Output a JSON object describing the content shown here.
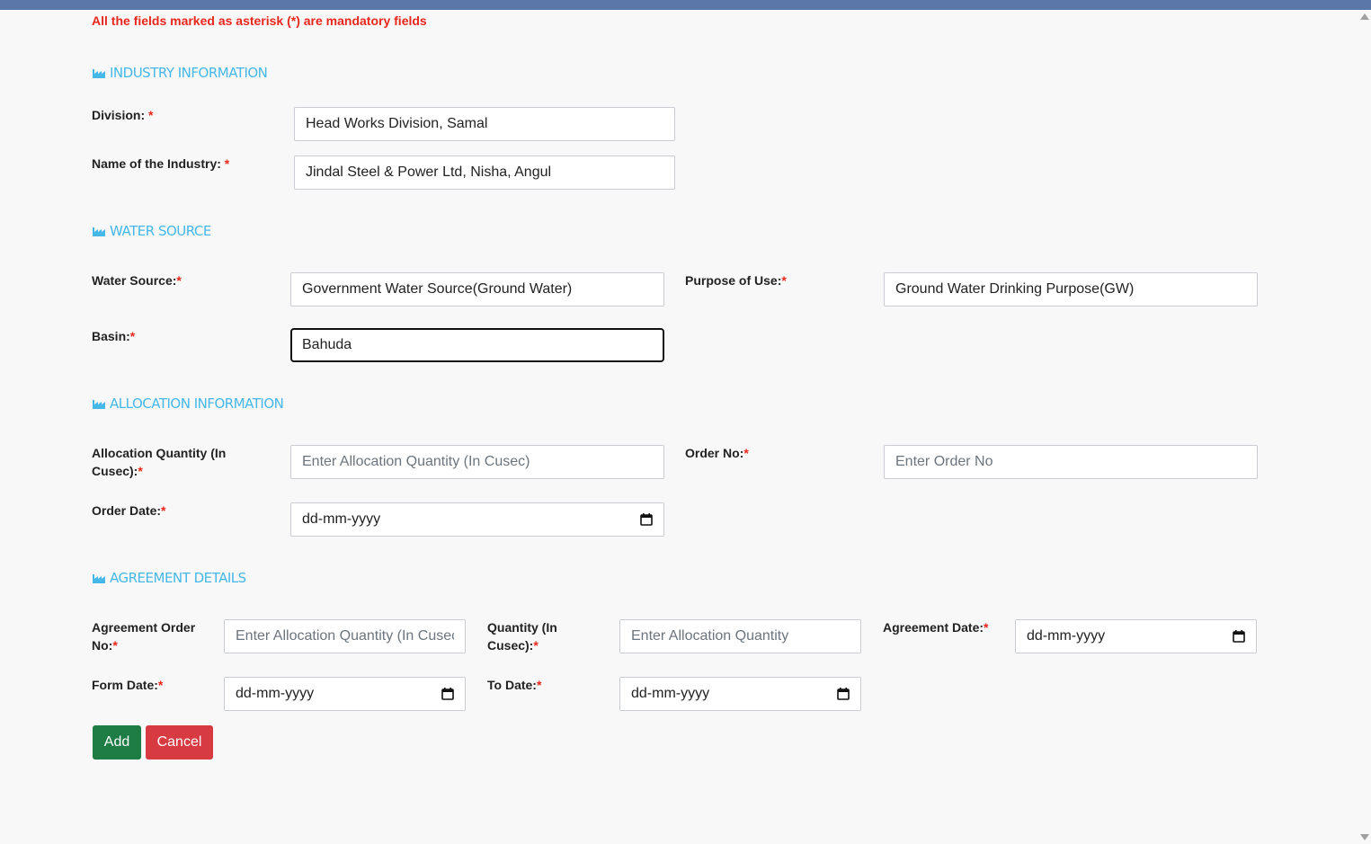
{
  "notice": "All the fields marked as asterisk (*) are mandatory fields",
  "colors": {
    "accent": "#45b8e8",
    "required": "#e8261c",
    "add": "#1e7c45",
    "cancel": "#d83a42",
    "topbar": "#5b76a8"
  },
  "sections": {
    "industry": "INDUSTRY INFORMATION",
    "water": "WATER SOURCE",
    "allocation": "ALLOCATION INFORMATION",
    "agreement": "AGREEMENT DETAILS"
  },
  "industry": {
    "division_label": "Division:",
    "division_value": "Head Works Division, Samal",
    "name_label": "Name of the Industry:",
    "name_value": "Jindal Steel & Power Ltd, Nisha, Angul"
  },
  "water": {
    "source_label": "Water Source:",
    "source_value": "Government Water Source(Ground Water)",
    "purpose_label": "Purpose of Use:",
    "purpose_value": "Ground Water Drinking Purpose(GW)",
    "basin_label": "Basin:",
    "basin_value": "Bahuda"
  },
  "allocation": {
    "qty_label_1": "Allocation Quantity (In",
    "qty_label_2": "Cusec):",
    "qty_placeholder": "Enter Allocation Quantity (In Cusec)",
    "order_no_label": "Order No:",
    "order_no_placeholder": "Enter Order No",
    "order_date_label": "Order Date:",
    "order_date_placeholder": "dd-mm-yyyy"
  },
  "agreement": {
    "order_no_label_1": "Agreement Order",
    "order_no_label_2": "No:",
    "order_no_placeholder": "Enter Allocation Quantity (In Cusec)",
    "qty_label_1": "Quantity (In",
    "qty_label_2": "Cusec):",
    "qty_placeholder": "Enter Allocation Quantity",
    "date_label": "Agreement Date:",
    "date_placeholder": "dd-mm-yyyy",
    "from_label": "Form Date:",
    "from_placeholder": "dd-mm-yyyy",
    "to_label": "To Date:",
    "to_placeholder": "dd-mm-yyyy"
  },
  "buttons": {
    "add": "Add",
    "cancel": "Cancel"
  },
  "required_mark": "*"
}
